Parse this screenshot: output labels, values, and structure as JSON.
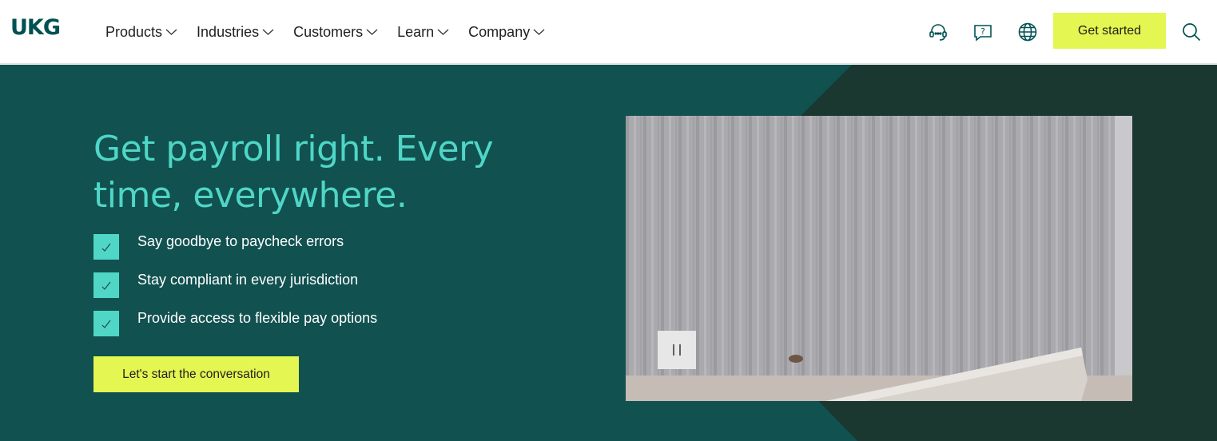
{
  "brand": {
    "logo_text": "UKG"
  },
  "nav": {
    "items": [
      {
        "label": "Products"
      },
      {
        "label": "Industries"
      },
      {
        "label": "Customers"
      },
      {
        "label": "Learn"
      },
      {
        "label": "Company"
      }
    ]
  },
  "header_actions": {
    "icons": [
      "headset-icon",
      "help-chat-icon",
      "globe-icon",
      "search-icon"
    ],
    "cta_label": "Get started"
  },
  "hero": {
    "headline": "Get payroll right. Every time, everywhere.",
    "bullets": [
      "Say goodbye to paycheck errors",
      "Stay compliant in every jurisdiction",
      "Provide access to flexible pay options"
    ],
    "cta_label": "Let's start the conversation"
  },
  "video": {
    "pause_icon_text": "| |"
  },
  "colors": {
    "brand_teal": "#005151",
    "hero_bg": "#115150",
    "hero_dark": "#1a3830",
    "accent_mint": "#4fd6c6",
    "cta_lime": "#e3f651"
  }
}
